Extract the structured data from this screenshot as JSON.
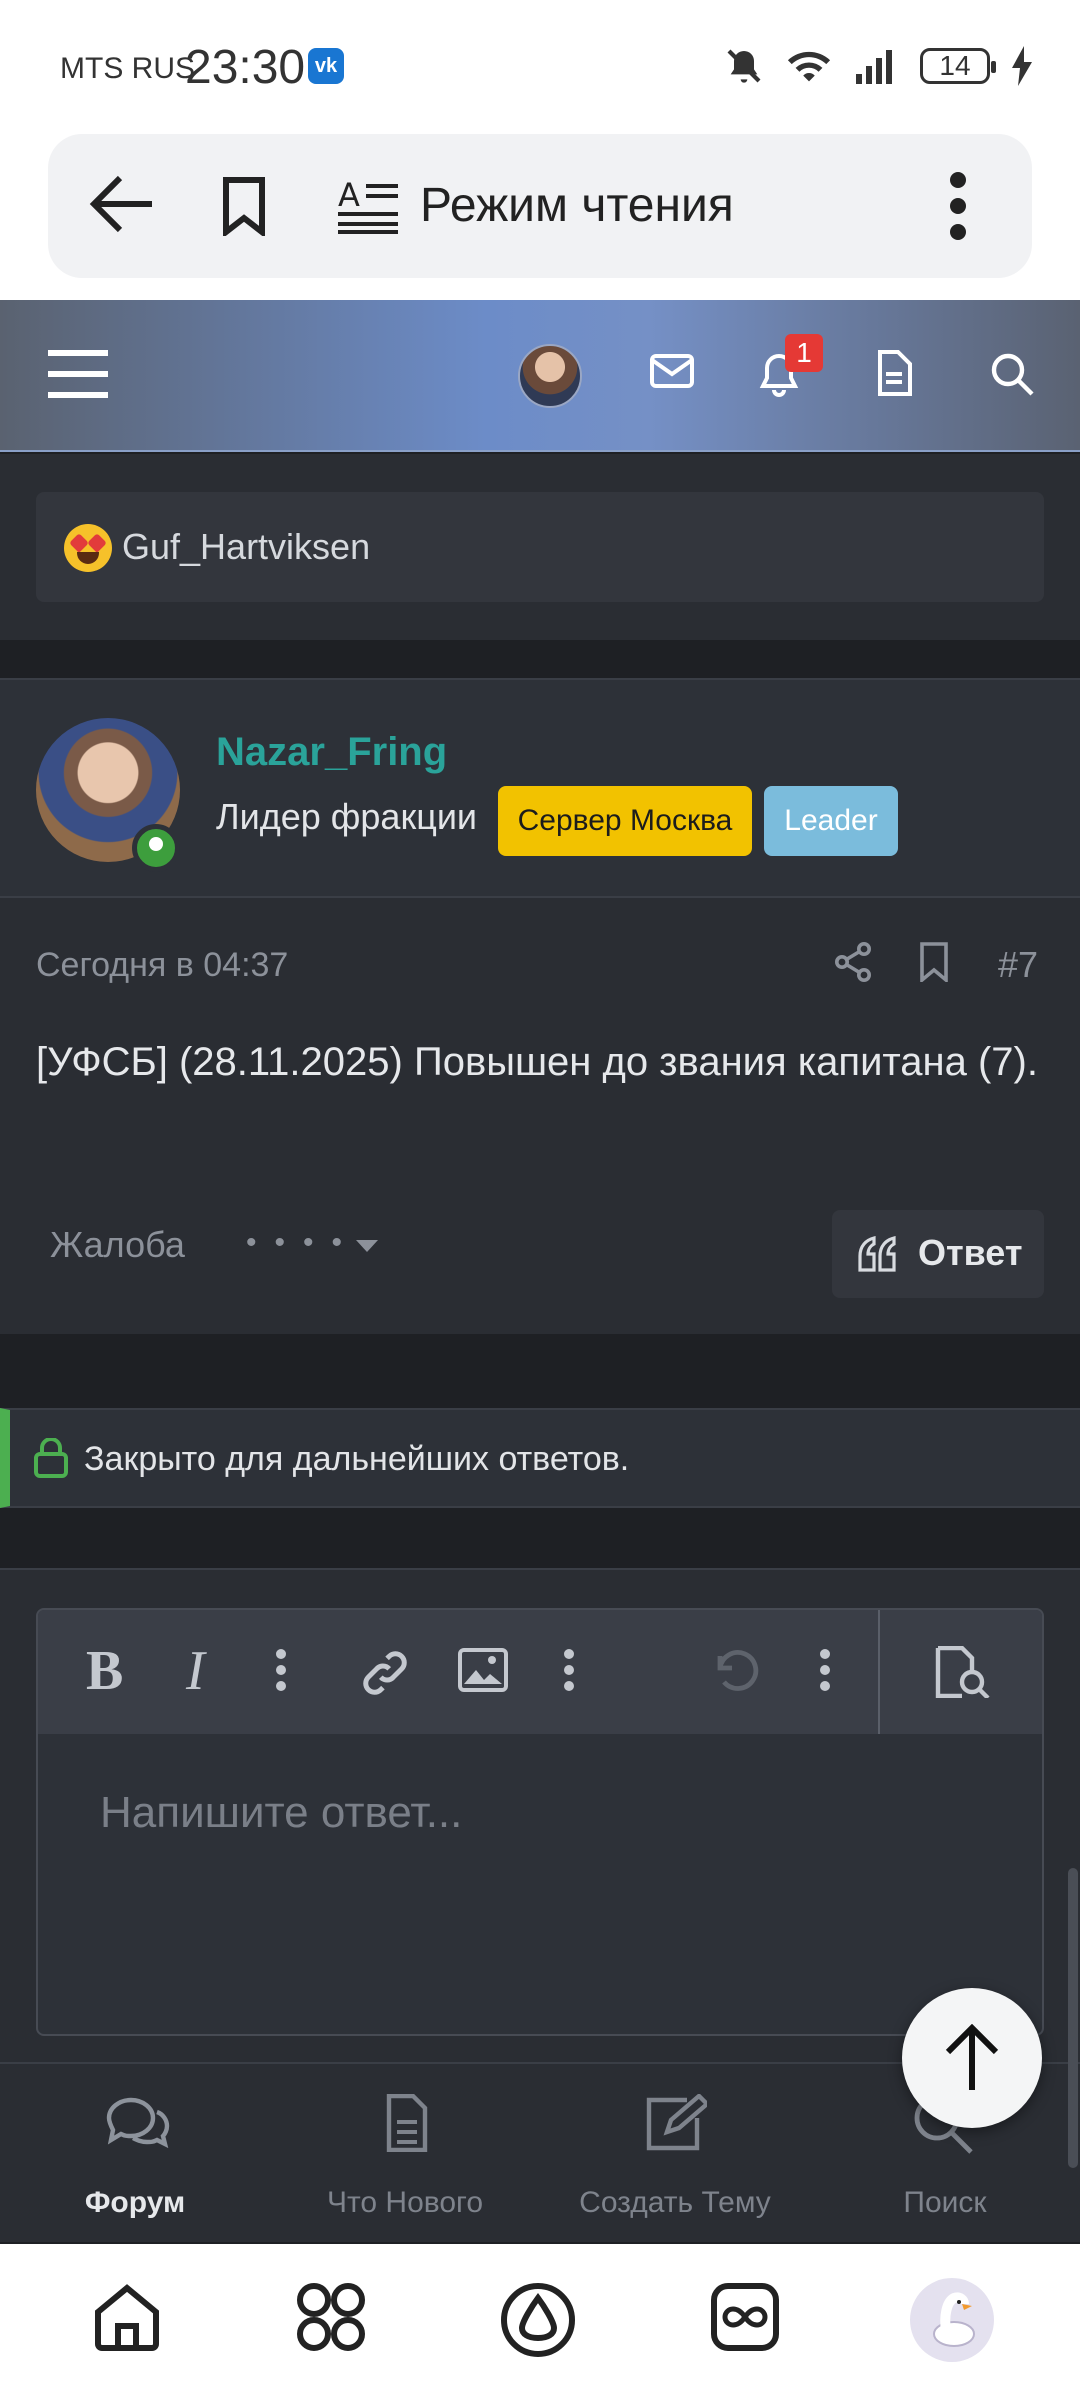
{
  "status_bar": {
    "carrier": "MTS RUS",
    "time": "23:30",
    "vk_label": "vk",
    "battery": "14"
  },
  "browser": {
    "reader_mode_label": "Режим чтения"
  },
  "site_header": {
    "notification_count": "1"
  },
  "previous_post": {
    "reaction_user": "Guf_Hartviksen"
  },
  "post": {
    "username": "Nazar_Fring",
    "user_title": "Лидер фракции",
    "badge_server": "Сервер Москва",
    "badge_leader": "Leader",
    "date": "Сегодня в 04:37",
    "number": "#7",
    "body": "[УФСБ] (28.11.2025) Повышен до звания капитана (7).",
    "report_label": "Жалоба",
    "reply_label": "Ответ"
  },
  "closed_notice": "Закрыто для дальнейших ответов.",
  "editor": {
    "placeholder": "Напишите ответ..."
  },
  "forum_nav": [
    {
      "label": "Форум",
      "icon": "comments-icon",
      "active": true
    },
    {
      "label": "Что Нового",
      "icon": "document-icon",
      "active": false
    },
    {
      "label": "Создать Тему",
      "icon": "edit-icon",
      "active": false
    },
    {
      "label": "Поиск",
      "icon": "search-icon",
      "active": false
    }
  ],
  "colors": {
    "username": "#2aa39a",
    "badge_server": "#f2c200",
    "badge_leader": "#7bbcdc",
    "closed_accent": "#4caf50",
    "notification_badge": "#e53935"
  }
}
